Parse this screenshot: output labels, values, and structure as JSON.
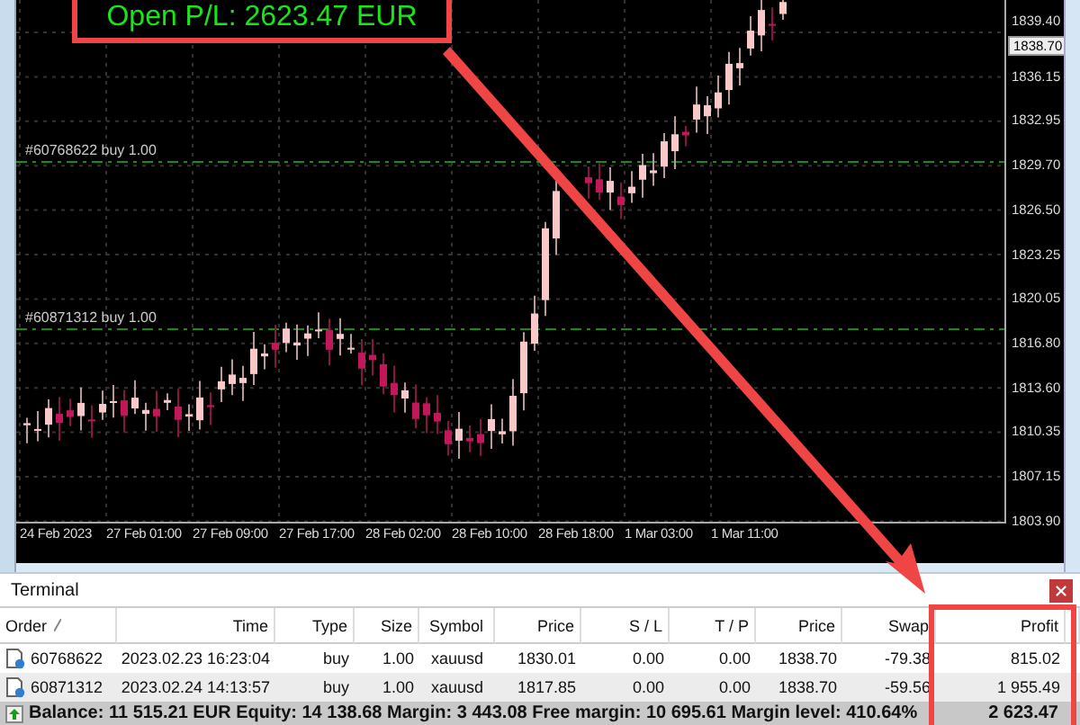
{
  "callout": {
    "text": "Open P/L: 2623.47 EUR"
  },
  "chart": {
    "price_labels": [
      "1839.40",
      "1836.15",
      "1832.95",
      "1829.70",
      "1826.50",
      "1823.25",
      "1820.05",
      "1816.80",
      "1813.60",
      "1810.35",
      "1807.15",
      "1803.90"
    ],
    "current_price": "1838.70",
    "time_labels": [
      "24 Feb 2023",
      "27 Feb 01:00",
      "27 Feb 09:00",
      "27 Feb 17:00",
      "28 Feb 02:00",
      "28 Feb 10:00",
      "28 Feb 18:00",
      "1 Mar 03:00",
      "1 Mar 11:00"
    ],
    "trade_lines": [
      {
        "label": "#60768622 buy 1.00"
      },
      {
        "label": "#60871312 buy 1.00"
      }
    ]
  },
  "terminal": {
    "title": "Terminal",
    "columns": [
      "Order",
      "Time",
      "Type",
      "Size",
      "Symbol",
      "Price",
      "S / L",
      "T / P",
      "Price",
      "Swap",
      "Profit"
    ],
    "rows": [
      {
        "cells": [
          "60768622",
          "2023.02.23 16:23:04",
          "buy",
          "1.00",
          "xauusd",
          "1830.01",
          "0.00",
          "0.00",
          "1838.70",
          "-79.38",
          "815.02"
        ]
      },
      {
        "cells": [
          "60871312",
          "2023.02.24 14:13:57",
          "buy",
          "1.00",
          "xauusd",
          "1817.85",
          "0.00",
          "0.00",
          "1838.70",
          "-59.56",
          "1 955.49"
        ]
      }
    ],
    "summary": "Balance: 11 515.21 EUR  Equity: 14 138.68  Margin: 3 443.08  Free margin: 10 695.61  Margin level: 410.64%",
    "total_profit": "2 623.47"
  }
}
